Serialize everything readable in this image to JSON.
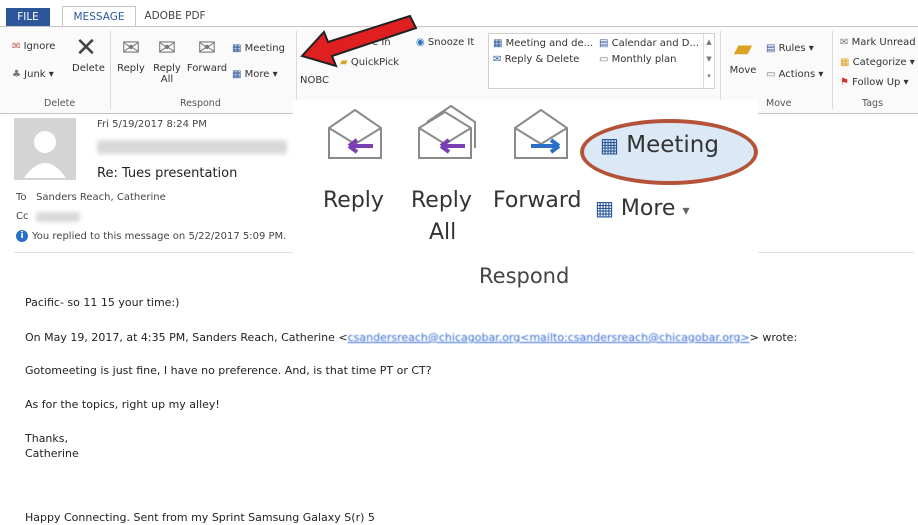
{
  "tabs": {
    "file": "FILE",
    "message": "MESSAGE",
    "adobe": "ADOBE PDF"
  },
  "ribbon": {
    "delete_group": {
      "ignore": "Ignore",
      "junk": "Junk",
      "delete": "Delete",
      "label": "Delete"
    },
    "respond_group": {
      "reply": "Reply",
      "reply_all_1": "Reply",
      "reply_all_2": "All",
      "forward": "Forward",
      "meeting": "Meeting",
      "more": "More",
      "label": "Respond"
    },
    "quick_steps": {
      "nobc": "NOBC",
      "move_in": "e In",
      "quickpick": "QuickPick",
      "snooze": "Snooze It",
      "meeting_and": "Meeting and de...",
      "calendar_and": "Calendar and D...",
      "reply_delete": "Reply & Delete",
      "monthly": "Monthly plan"
    },
    "move_group": {
      "move": "Move",
      "rules": "Rules",
      "actions": "Actions",
      "label": "Move"
    },
    "tags_group": {
      "mark_unread": "Mark Unread",
      "categorize": "Categorize",
      "follow_up": "Follow Up",
      "label": "Tags"
    }
  },
  "email": {
    "date": "Fri 5/19/2017 8:24 PM",
    "subject": "Re: Tues presentation",
    "to_label": "To",
    "to": "Sanders Reach, Catherine",
    "cc_label": "Cc",
    "info": "You replied to this message on 5/22/2017 5:09 PM."
  },
  "zoom": {
    "reply": "Reply",
    "reply_all_1": "Reply",
    "reply_all_2": "All",
    "forward": "Forward",
    "meeting": "Meeting",
    "more": "More",
    "respond": "Respond"
  },
  "body": {
    "line1": "Pacific- so 11 15 your time:)",
    "line2_pre": "On May 19, 2017, at 4:35 PM, Sanders Reach, Catherine <",
    "line2_link": "csandersreach@chicagobar.org<mailto:csandersreach@chicagobar.org>",
    "line2_post": "> wrote:",
    "line3": "Gotomeeting is just fine, I have no preference. And, is that time PT or CT?",
    "line4": "As for the topics, right up my alley!",
    "line5": "Thanks,",
    "line6": "Catherine",
    "line7": "Happy Connecting. Sent from my Sprint Samsung Galaxy S(r) 5"
  },
  "colors": {
    "accent": "#2b579a",
    "arrow": "#e02020",
    "oval": "#b5533a",
    "link": "#3a6fd8"
  }
}
